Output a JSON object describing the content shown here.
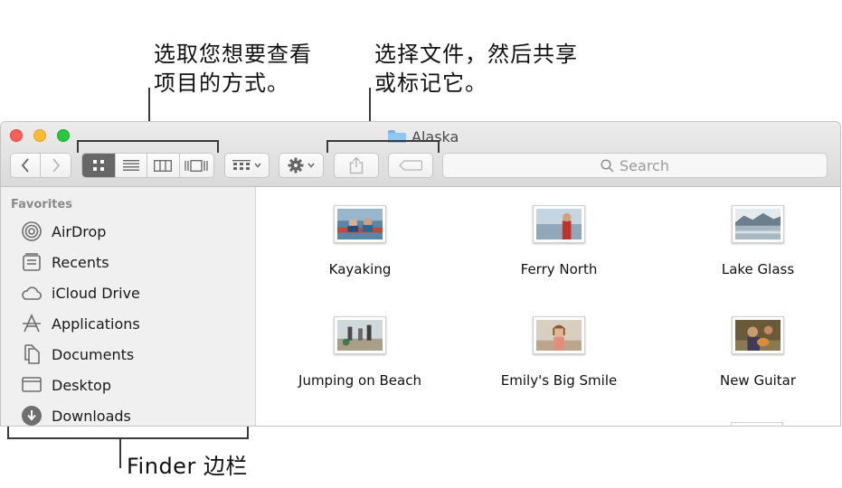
{
  "annotations": {
    "view_modes_line1": "选取您想要查看",
    "view_modes_line2": "项目的方式。",
    "share_tag_line1": "选择文件，然后共享",
    "share_tag_line2": "或标记它。",
    "sidebar_label": "Finder 边栏"
  },
  "window": {
    "title": "Alaska",
    "search_placeholder": "Search",
    "view_mode_selected": "icon",
    "icons": {
      "back": "chevron-left-icon",
      "forward": "chevron-right-icon",
      "views": [
        "icon-view-icon",
        "list-view-icon",
        "column-view-icon",
        "gallery-view-icon"
      ],
      "group": "group-by-icon",
      "action": "gear-icon",
      "share": "share-icon",
      "tag": "tag-icon",
      "search": "magnifier-icon"
    }
  },
  "sidebar": {
    "heading": "Favorites",
    "items": [
      {
        "label": "AirDrop",
        "icon": "airdrop-icon"
      },
      {
        "label": "Recents",
        "icon": "recents-icon"
      },
      {
        "label": "iCloud Drive",
        "icon": "cloud-icon"
      },
      {
        "label": "Applications",
        "icon": "applications-icon"
      },
      {
        "label": "Documents",
        "icon": "documents-icon"
      },
      {
        "label": "Desktop",
        "icon": "desktop-icon"
      },
      {
        "label": "Downloads",
        "icon": "downloads-icon"
      }
    ]
  },
  "files": [
    {
      "name": "Kayaking"
    },
    {
      "name": "Ferry North"
    },
    {
      "name": "Lake Glass"
    },
    {
      "name": "Jumping on Beach"
    },
    {
      "name": "Emily's Big Smile"
    },
    {
      "name": "New Guitar"
    }
  ],
  "colors": {
    "close": "#fc5f57",
    "minimize": "#fdbc2e",
    "zoom": "#28c840",
    "selected_view": "#676767",
    "sidebar_bg": "#f0f0f0"
  }
}
